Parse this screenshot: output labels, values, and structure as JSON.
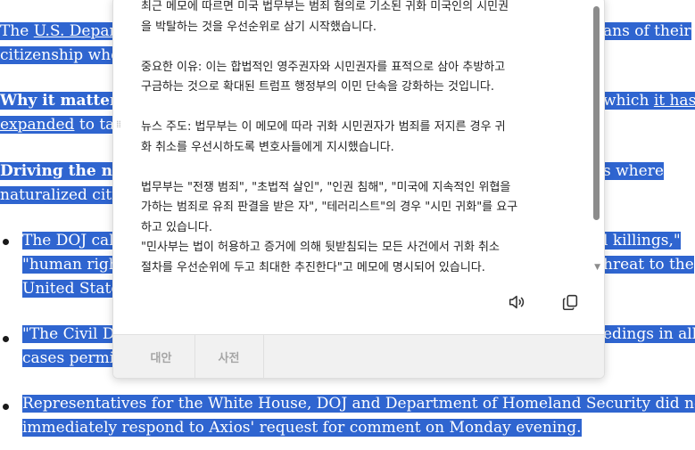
{
  "article": {
    "p1_line1_a": "The ",
    "p1_link": "U.S. Depart",
    "p1_line1_b": "ans of their",
    "p1_line2": "citizenship whe",
    "p2_bold": "Why it matters",
    "p2_line1_b": "which ",
    "p2_link_a": "it has",
    "p2_link_b": "expanded",
    "p2_line2_b": " to tar",
    "p3_bold": "Driving the nev",
    "p3_line1_b": "s where",
    "p3_line2": "naturalized citi",
    "b1_line1_a": "The DOJ cal",
    "b1_line1_b": "l killings,\"",
    "b1_line2_a": "\"human righ",
    "b1_line2_b": "hreat to the",
    "b1_line3": "United State",
    "b2_line1_a": "\"The Civil Di",
    "b2_line1_b": "edings in all",
    "b2_line2": "cases permit",
    "b3_line1": "Representatives for the White House, DOJ and Department of Homeland Security did not",
    "b3_line2": "immediately respond to Axios' request for comment on Monday evening."
  },
  "popup": {
    "text": "최근 메모에 따르면 미국 법무부는 범죄 혐의로 기소된 귀화 미국인의 시민권\n을 박탈하는 것을 우선순위로 삼기 시작했습니다.\n\n중요한 이유: 이는 합법적인 영주권자와 시민권자를 표적으로 삼아 추방하고\n구금하는 것으로 확대된 트럼프 행정부의 이민 단속을 강화하는 것입니다.\n\n뉴스 주도: 법무부는 이 메모에 따라 귀화 시민권자가 범죄를 저지른 경우 귀\n화 취소를 우선시하도록 변호사들에게 지시했습니다.\n\n법무부는 \"전쟁 범죄\", \"초법적 살인\", \"인권 침해\", \"미국에 지속적인 위협을\n가하는 범죄로 유죄 판결을 받은 자\", \"테러리스트\"의 경우 \"시민 귀화\"를 요구\n하고 있습니다.\n\"민사부는 법이 허용하고 증거에 의해 뒷받침되는 모든 사건에서 귀화 취소\n절차를 우선순위에 두고 최대한 추진한다\"고 메모에 명시되어 있습니다.",
    "speaker_icon": "speaker-icon",
    "copy_icon": "copy-icon",
    "tabs": [
      "대안",
      "사전"
    ]
  }
}
